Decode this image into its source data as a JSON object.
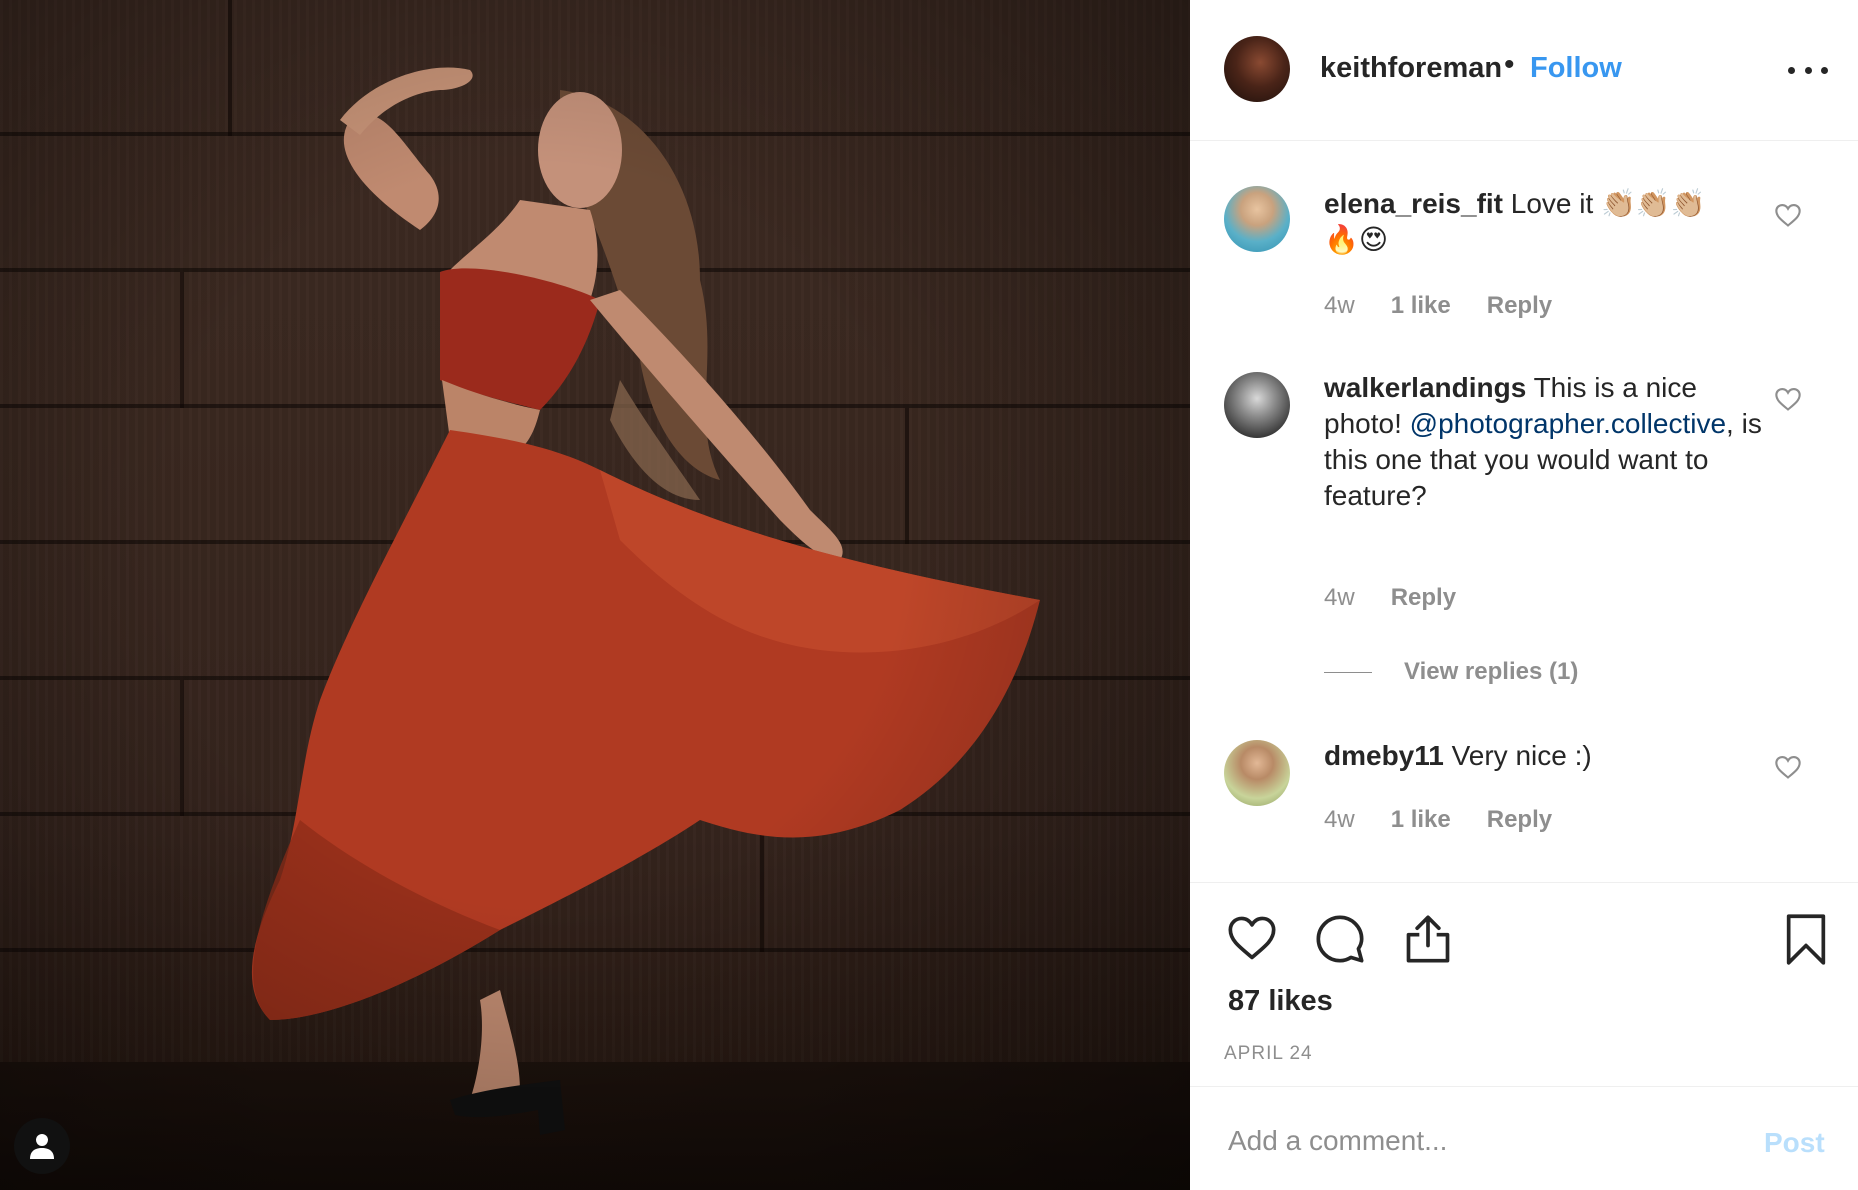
{
  "post": {
    "author": "keithforeman",
    "separator": "•",
    "follow_label": "Follow",
    "more_icon": "more-horizontal-icon",
    "likes_text": "87 likes",
    "date": "APRIL 24",
    "photo_alt": "user-profile-icon"
  },
  "comments": [
    {
      "user": "elena_reis_fit",
      "text_line1": "Love it 👏🏼👏🏼👏🏼",
      "text_line2": "🔥😍",
      "time": "4w",
      "likes": "1 like",
      "reply": "Reply"
    },
    {
      "user": "walkerlandings",
      "text_before": "This is a nice photo!",
      "mention": "@photographer.collective",
      "text_after": ", is this one that you would want to feature?",
      "time": "4w",
      "reply": "Reply",
      "view_replies": "View replies (1)"
    },
    {
      "user": "dmeby11",
      "text": "Very nice :)",
      "time": "4w",
      "likes": "1 like",
      "reply": "Reply"
    }
  ],
  "composer": {
    "placeholder": "Add a comment...",
    "post_label": "Post"
  },
  "colors": {
    "accent": "#3897f0",
    "text": "#262626",
    "muted": "#8e8e8e",
    "mention": "#003569",
    "post_disabled": "#b9dffc"
  }
}
